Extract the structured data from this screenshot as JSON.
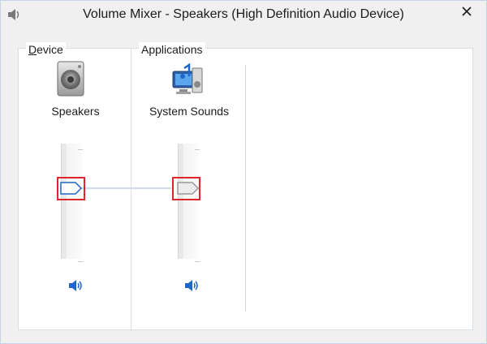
{
  "window": {
    "title": "Volume Mixer - Speakers (High Definition Audio Device)",
    "icon": "volume-mixer-icon",
    "close_icon": "close-icon"
  },
  "device": {
    "group_label": "Device",
    "mnemonic": "D",
    "icon": "speaker-icon",
    "name": "Speakers",
    "volume_percent": 65,
    "mute_icon": "speaker-volume-icon"
  },
  "applications": {
    "group_label": "Applications",
    "items": [
      {
        "name": "System Sounds",
        "icon": "system-sounds-icon",
        "volume_percent": 65,
        "mute_icon": "speaker-volume-icon"
      }
    ]
  },
  "colors": {
    "accent": "#1e66c8",
    "highlight": "#e0242b"
  }
}
